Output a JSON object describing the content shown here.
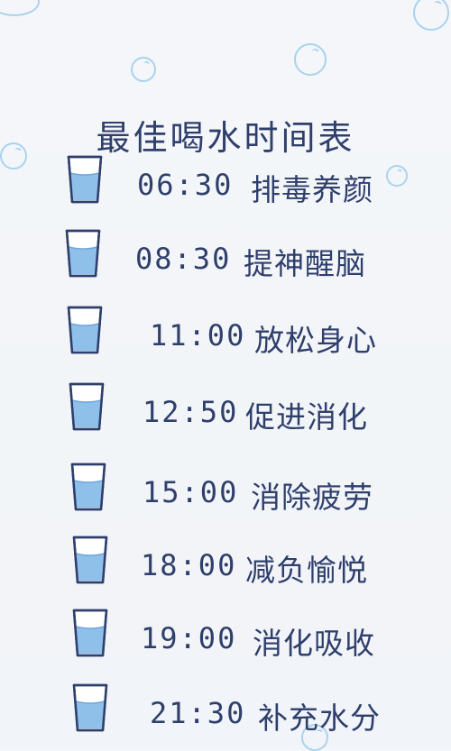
{
  "title": "最佳喝水时间表",
  "schedule": [
    {
      "time": "06:30",
      "label": "排毒养颜"
    },
    {
      "time": "08:30",
      "label": "提神醒脑"
    },
    {
      "time": "11:00",
      "label": "放松身心"
    },
    {
      "time": "12:50",
      "label": "促进消化"
    },
    {
      "time": "15:00",
      "label": "消除疲劳"
    },
    {
      "time": "18:00",
      "label": "减负愉悦"
    },
    {
      "time": "19:00",
      "label": "消化吸收"
    },
    {
      "time": "21:30",
      "label": "补充水分"
    }
  ],
  "colors": {
    "text": "#2f3f6c",
    "water": "#8fc0ea",
    "bubble": "#a9d3ee",
    "background": "#f4f6f9"
  },
  "icons": {
    "glass": "water-glass-icon",
    "bubble": "bubble-icon"
  }
}
